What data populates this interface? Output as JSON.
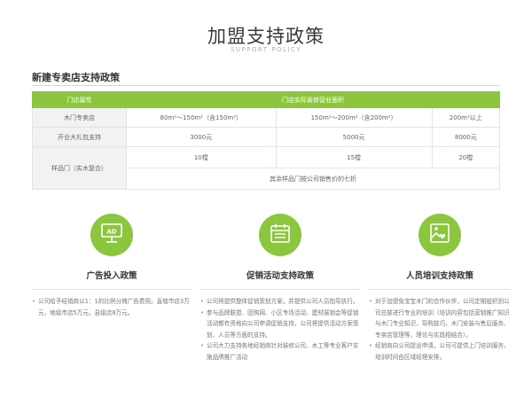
{
  "hero": {
    "title": "加盟支持政策",
    "subtitle": "SUPPORT POLICY"
  },
  "section": {
    "title": "新建专卖店支持政策"
  },
  "table": {
    "headers": [
      "门店属性",
      "门店实际装修营业面积"
    ],
    "rows": {
      "store": {
        "label": "木门专卖店",
        "c1": "80m²～150m²（含150m²）",
        "c2": "150m²～200m²（含200m²）",
        "c3": "200m²以上"
      },
      "gift": {
        "label": "开业大礼包支持",
        "c1": "3000元",
        "c2": "5000元",
        "c3": "8000元"
      },
      "sample": {
        "label": "样品门（实木复合）",
        "c1": "10樘",
        "c2": "15樘",
        "c3": "20樘",
        "note": "其余样品门按公司销售价的七折"
      }
    }
  },
  "features": [
    {
      "title": "广告投入政策",
      "icon": "ad-board-icon",
      "icon_text": "AD",
      "items": [
        "公司给予经销商以1：1的比例分摊广告费用。直辖市店3万元，地级市店5万元，县级店8万元。"
      ]
    },
    {
      "title": "促销活动支持政策",
      "icon": "calendar-icon",
      "items": [
        "公司将提供整体促销策划方案，并提供公司人员指导执行。",
        "参与品牌联盟、团购网、小区专场活动、建材展销会等促销活动都有资格向公司申请促销支持，公司将提供活动方案策划、人员等方面的支持。",
        "公司大力支持各地经销商针对装修公司、木工等专业客户实施品牌推广活动"
      ]
    },
    {
      "title": "人员培训支持政策",
      "icon": "picture-heart-icon",
      "items": [
        "对于加盟免宝宝木门的合作伙伴，公司定期组织到公司总部进行专业的培训（培训内容包括营销推广知识与木门专业知识，导购技巧，木门安装与售后服务、专卖店管理等，理论与实践相结合）。",
        "经销商向公司提出申请，公司可提供上门培训服务，培训时间由区域经理安排。"
      ]
    }
  ],
  "colors": {
    "accent": "#8cc63f",
    "label_bg": "#f2f2f2"
  }
}
